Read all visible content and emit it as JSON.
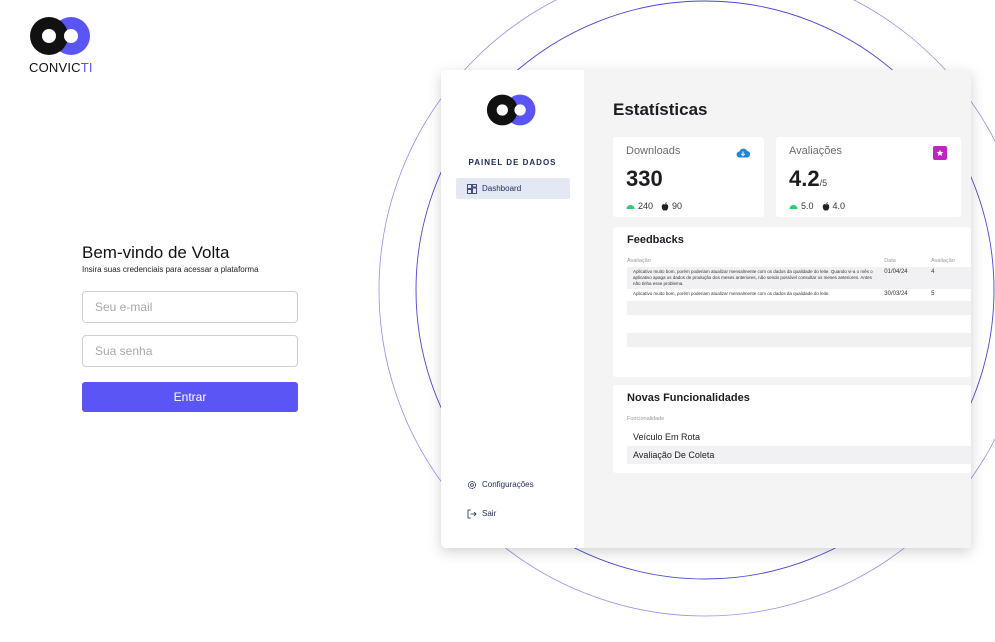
{
  "brand": {
    "name_main": "CONVIC",
    "name_accent": "TI",
    "colors": {
      "accent": "#5b55f5",
      "dark": "#111111"
    }
  },
  "login": {
    "title": "Bem-vindo de Volta",
    "subtitle": "Insira suas credenciais para acessar a plataforma",
    "email_placeholder": "Seu e-mail",
    "password_placeholder": "Sua senha",
    "submit_label": "Entrar"
  },
  "preview": {
    "sidebar": {
      "panel_title": "PAINEL DE DADOS",
      "nav_dashboard": "Dashboard",
      "nav_settings": "Configurações",
      "nav_logout": "Sair"
    },
    "title": "Estatísticas",
    "downloads": {
      "label": "Downloads",
      "value": "330",
      "android": "240",
      "ios": "90",
      "icon": "cloud-download-icon"
    },
    "ratings": {
      "label": "Avaliações",
      "value": "4.2",
      "unit": "/5",
      "android": "5.0",
      "ios": "4.0",
      "icon": "star-badge-icon"
    },
    "feedbacks": {
      "title": "Feedbacks",
      "col_review": "Avaliação",
      "col_date": "Data",
      "col_rating": "Avaliação",
      "rows": [
        {
          "text": "Aplicativo muito bom, porém poderiam atualizar mensalmente com os dados da qualidade do leite. Quando vi-a o mês o aplicativo apaga os dados de produção dos meses anteriores, não sendo possível consultar os meses anteriores. Antes não tinha esse problema.",
          "date": "01/04/24",
          "rating": "4"
        },
        {
          "text": "Aplicativo muito bom, porém poderiam atualizar mensalmente com os dados da qualidade do leite.",
          "date": "30/03/24",
          "rating": "5"
        }
      ]
    },
    "features": {
      "title": "Novas Funcionalidades",
      "col": "Funcionalidade",
      "items": [
        "Veículo Em Rota",
        "Avaliação De Coleta"
      ]
    }
  }
}
